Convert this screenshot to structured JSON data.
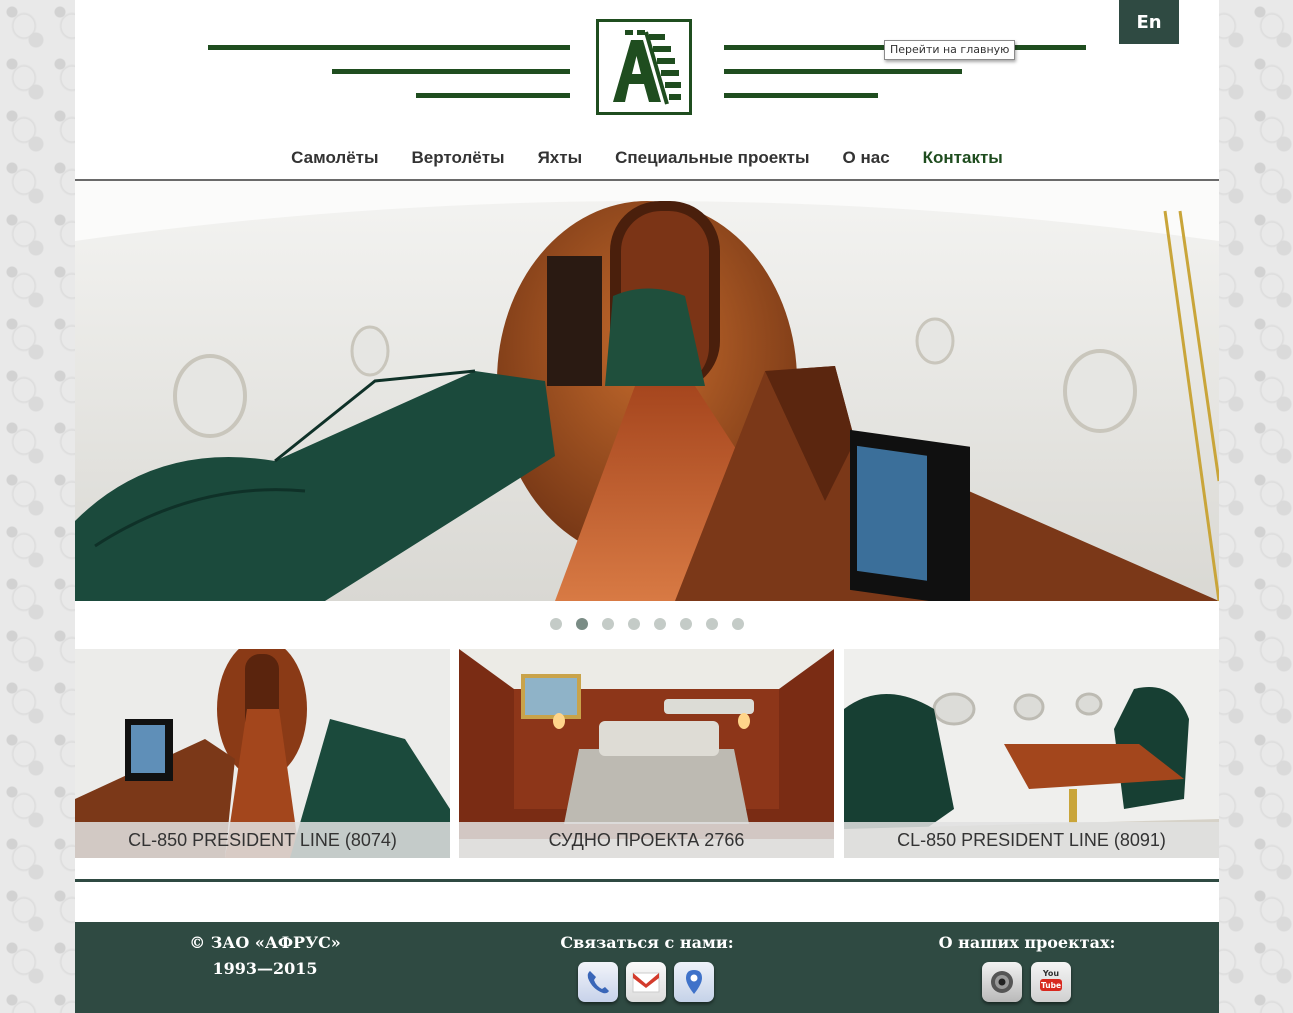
{
  "header": {
    "lang_button": "En",
    "tooltip": "Перейти на главную",
    "logo_icon": "afrus-logo-icon",
    "brand_color": "#1f4d1f"
  },
  "nav": {
    "items": [
      "Самолёты",
      "Вертолёты",
      "Яхты",
      "Специальные проекты",
      "О нас",
      "Контакты"
    ],
    "active": "Контакты"
  },
  "slider": {
    "slide_count": 8,
    "active_index": 1
  },
  "projects": [
    {
      "caption": "CL-850 PRESIDENT LINE (8074)"
    },
    {
      "caption": "СУДНО ПРОЕКТА 2766"
    },
    {
      "caption": "CL-850 PRESIDENT LINE (8091)"
    }
  ],
  "footer": {
    "copyright_line1": "© ЗАО «АФРУС»",
    "copyright_line2": "1993—2015",
    "contact_title": "Связаться с нами:",
    "projects_title": "О наших проектах:",
    "contact_icons": [
      "phone-icon",
      "gmail-icon",
      "map-pin-icon"
    ],
    "project_icons": [
      "camera-icon",
      "youtube-icon"
    ],
    "background": "#2f4a42"
  }
}
